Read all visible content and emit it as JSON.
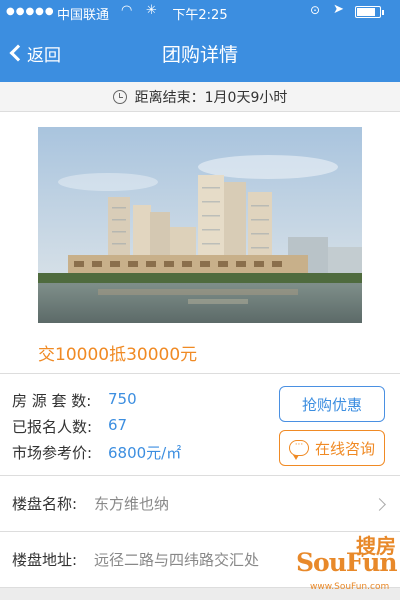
{
  "status_bar": {
    "signal": "●●●●●",
    "carrier": "中国联通",
    "time": "下午2:25"
  },
  "nav": {
    "back_label": "返回",
    "title": "团购详情"
  },
  "countdown": {
    "label": "距离结束：",
    "remaining": "1月0天9小时"
  },
  "promo": {
    "offer": "交10000抵30000元",
    "photo_watermark": "SouFun"
  },
  "stats": [
    {
      "label": "房 源 套 数:",
      "value": "750"
    },
    {
      "label": "已报名人数:",
      "value": "67"
    },
    {
      "label": "市场参考价:",
      "value": "6800元/㎡"
    }
  ],
  "actions": {
    "buy_label": "抢购优惠",
    "chat_label": "在线咨询"
  },
  "info": [
    {
      "label": "楼盘名称:",
      "value": "东方维也纳"
    },
    {
      "label": "楼盘地址:",
      "value": "远径二路与四纬路交汇处"
    }
  ],
  "watermark": {
    "brand": "SouFun",
    "brand_cn": "搜房",
    "url": "www.SouFun.com"
  },
  "colors": {
    "header": "#3c8ee0",
    "accent_orange": "#f08a24",
    "link_blue": "#3c8ee0"
  },
  "battery_level": 0.75
}
